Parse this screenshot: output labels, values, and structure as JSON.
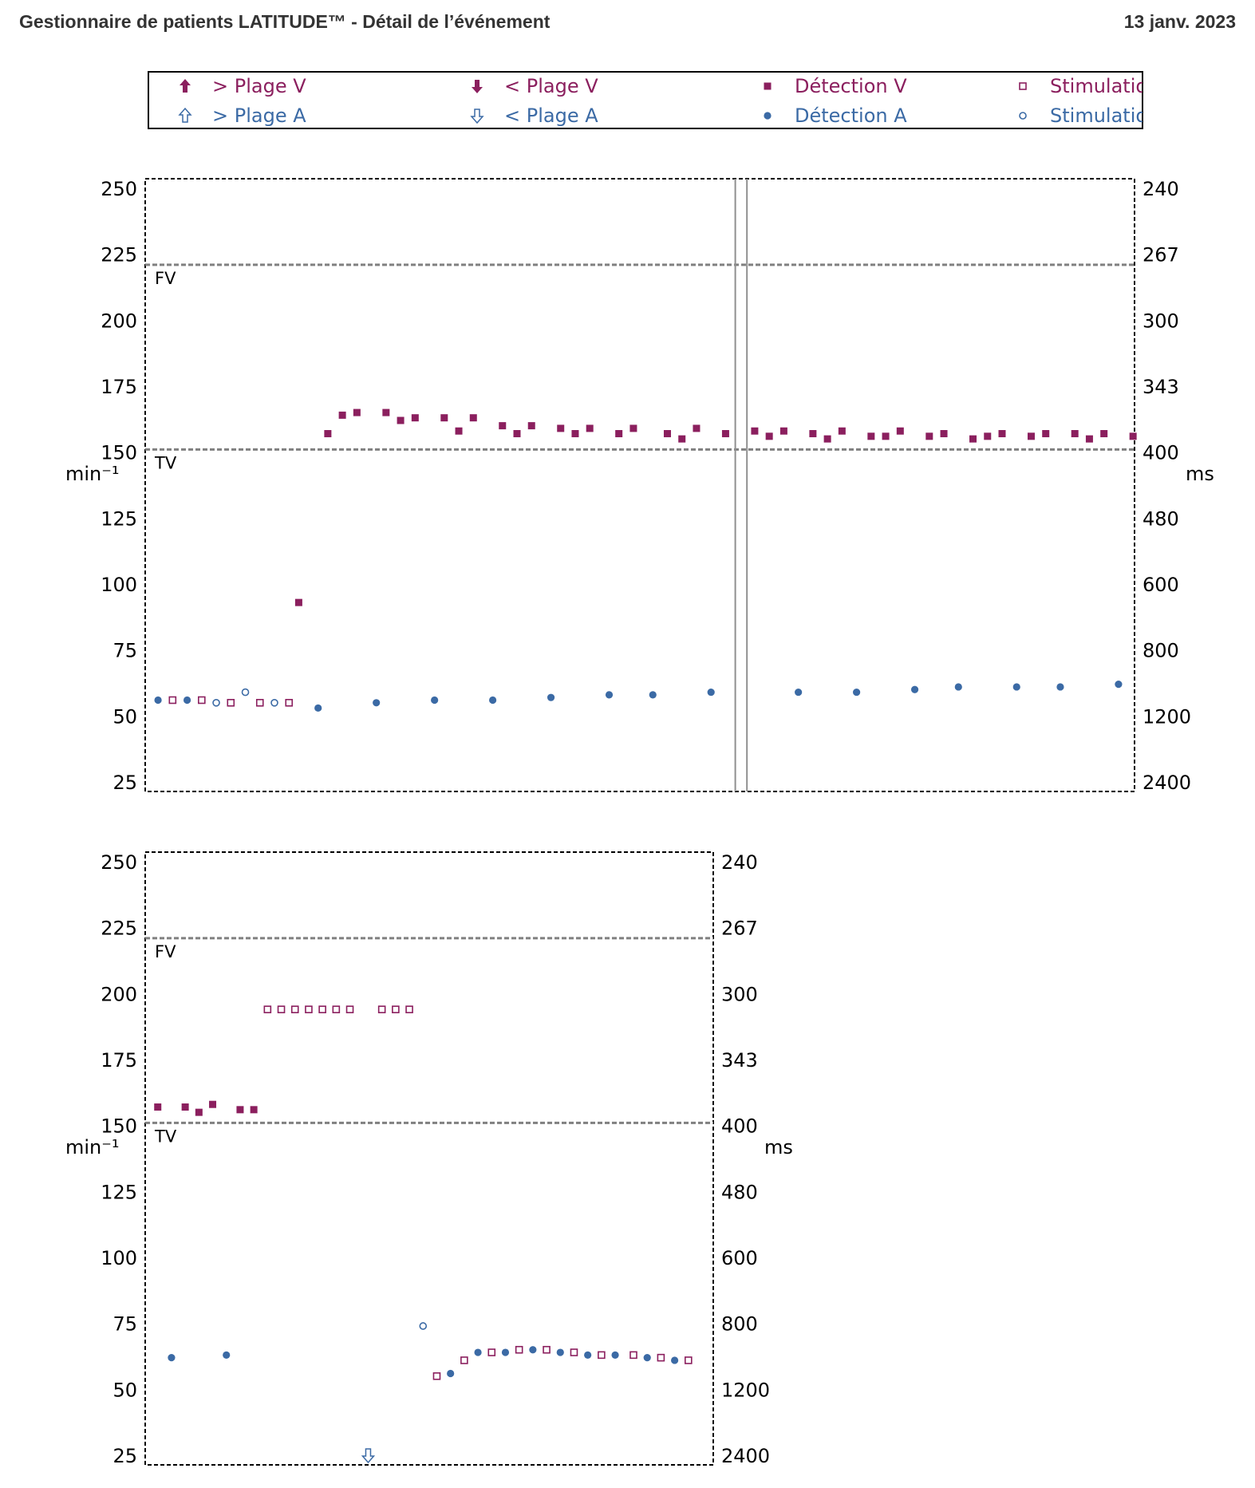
{
  "header": {
    "title": "Gestionnaire de patients LATITUDE™ - Détail de l’événement",
    "date": "13 janv. 2023"
  },
  "colors": {
    "ventricular": "#8b1f5e",
    "atrial": "#3b6aa5",
    "threshold_line": "#808080",
    "marker_line": "#909090"
  },
  "legend": {
    "items": [
      {
        "label": "> Plage V",
        "icon": "filled-up-arrow-icon",
        "color": "#8b1f5e"
      },
      {
        "label": "< Plage V",
        "icon": "filled-down-arrow-icon",
        "color": "#8b1f5e"
      },
      {
        "label": "Détection V",
        "icon": "filled-square-icon",
        "color": "#8b1f5e"
      },
      {
        "label": "Stimulation V",
        "icon": "open-square-icon",
        "color": "#8b1f5e"
      },
      {
        "label": "> Plage A",
        "icon": "open-up-arrow-icon",
        "color": "#3b6aa5"
      },
      {
        "label": "< Plage A",
        "icon": "open-down-arrow-icon",
        "color": "#3b6aa5"
      },
      {
        "label": "Détection A",
        "icon": "filled-circle-icon",
        "color": "#3b6aa5"
      },
      {
        "label": "Stimulation A",
        "icon": "open-circle-icon",
        "color": "#3b6aa5"
      }
    ]
  },
  "chart_data": [
    {
      "type": "scatter",
      "ylabel_left": "min⁻¹",
      "ylabel_right": "ms",
      "ylim": [
        25,
        250
      ],
      "yticks_left": [
        "250",
        "225",
        "200",
        "175",
        "150",
        "125",
        "100",
        "75",
        "50",
        "25"
      ],
      "yticks_right": [
        "240",
        "267",
        "300",
        "343",
        "400",
        "480",
        "600",
        "800",
        "1200",
        "2400"
      ],
      "xlim": [
        0,
        1000
      ],
      "thresholds": [
        {
          "label": "FV",
          "value": 221
        },
        {
          "label": "TV",
          "value": 151
        }
      ],
      "event_markers": [
        600,
        612
      ],
      "series": [
        {
          "name": "Détection V",
          "marker": "filled-square",
          "points": [
            [
              150,
              93
            ],
            [
              180,
              157
            ],
            [
              195,
              164
            ],
            [
              210,
              165
            ],
            [
              240,
              165
            ],
            [
              255,
              162
            ],
            [
              270,
              163
            ],
            [
              300,
              163
            ],
            [
              315,
              158
            ],
            [
              330,
              163
            ],
            [
              360,
              160
            ],
            [
              375,
              157
            ],
            [
              390,
              160
            ],
            [
              420,
              159
            ],
            [
              435,
              157
            ],
            [
              450,
              159
            ],
            [
              480,
              157
            ],
            [
              495,
              159
            ],
            [
              530,
              157
            ],
            [
              545,
              155
            ],
            [
              560,
              159
            ],
            [
              590,
              157
            ],
            [
              620,
              158
            ],
            [
              635,
              156
            ],
            [
              650,
              158
            ],
            [
              680,
              157
            ],
            [
              695,
              155
            ],
            [
              710,
              158
            ],
            [
              740,
              156
            ],
            [
              755,
              156
            ],
            [
              770,
              158
            ],
            [
              800,
              156
            ],
            [
              815,
              157
            ],
            [
              845,
              155
            ],
            [
              860,
              156
            ],
            [
              875,
              157
            ],
            [
              905,
              156
            ],
            [
              920,
              157
            ],
            [
              950,
              157
            ],
            [
              965,
              155
            ],
            [
              980,
              157
            ],
            [
              1010,
              156
            ]
          ]
        },
        {
          "name": "Stimulation V",
          "marker": "open-square",
          "points": [
            [
              20,
              56
            ],
            [
              50,
              56
            ],
            [
              80,
              55
            ],
            [
              110,
              55
            ],
            [
              140,
              55
            ]
          ]
        },
        {
          "name": "Détection A",
          "marker": "filled-circle",
          "points": [
            [
              5,
              56
            ],
            [
              35,
              56
            ],
            [
              170,
              53
            ],
            [
              230,
              55
            ],
            [
              290,
              56
            ],
            [
              350,
              56
            ],
            [
              410,
              57
            ],
            [
              470,
              58
            ],
            [
              515,
              58
            ],
            [
              575,
              59
            ],
            [
              665,
              59
            ],
            [
              725,
              59
            ],
            [
              785,
              60
            ],
            [
              830,
              61
            ],
            [
              890,
              61
            ],
            [
              935,
              61
            ],
            [
              995,
              62
            ]
          ]
        },
        {
          "name": "Stimulation A",
          "marker": "open-circle",
          "points": [
            [
              65,
              55
            ],
            [
              95,
              59
            ],
            [
              125,
              55
            ]
          ]
        }
      ]
    },
    {
      "type": "scatter",
      "ylabel_left": "min⁻¹",
      "ylabel_right": "ms",
      "ylim": [
        25,
        250
      ],
      "yticks_left": [
        "250",
        "225",
        "200",
        "175",
        "150",
        "125",
        "100",
        "75",
        "50",
        "25"
      ],
      "yticks_right": [
        "240",
        "267",
        "300",
        "343",
        "400",
        "480",
        "600",
        "800",
        "1200",
        "2400"
      ],
      "xlim": [
        0,
        600
      ],
      "thresholds": [
        {
          "label": "FV",
          "value": 221
        },
        {
          "label": "TV",
          "value": 151
        }
      ],
      "series": [
        {
          "name": "Détection V",
          "marker": "filled-square",
          "points": [
            [
              5,
              157
            ],
            [
              35,
              157
            ],
            [
              50,
              155
            ],
            [
              65,
              158
            ],
            [
              95,
              156
            ],
            [
              110,
              156
            ]
          ]
        },
        {
          "name": "Stimulation V",
          "marker": "open-square",
          "points": [
            [
              125,
              194
            ],
            [
              140,
              194
            ],
            [
              155,
              194
            ],
            [
              170,
              194
            ],
            [
              185,
              194
            ],
            [
              200,
              194
            ],
            [
              215,
              194
            ],
            [
              250,
              194
            ],
            [
              265,
              194
            ],
            [
              280,
              194
            ],
            [
              310,
              55
            ],
            [
              340,
              61
            ],
            [
              370,
              64
            ],
            [
              400,
              65
            ],
            [
              430,
              65
            ],
            [
              460,
              64
            ],
            [
              490,
              63
            ],
            [
              525,
              63
            ],
            [
              555,
              62
            ],
            [
              585,
              61
            ]
          ]
        },
        {
          "name": "Détection A",
          "marker": "filled-circle",
          "points": [
            [
              20,
              62
            ],
            [
              80,
              63
            ],
            [
              325,
              56
            ],
            [
              355,
              64
            ],
            [
              385,
              64
            ],
            [
              415,
              65
            ],
            [
              445,
              64
            ],
            [
              475,
              63
            ],
            [
              505,
              63
            ],
            [
              540,
              62
            ],
            [
              570,
              61
            ]
          ]
        },
        {
          "name": "Stimulation A",
          "marker": "open-circle",
          "points": [
            [
              295,
              74
            ]
          ]
        },
        {
          "name": "< Plage A",
          "marker": "open-down-arrow",
          "points": [
            [
              235,
              25
            ]
          ]
        }
      ]
    }
  ]
}
